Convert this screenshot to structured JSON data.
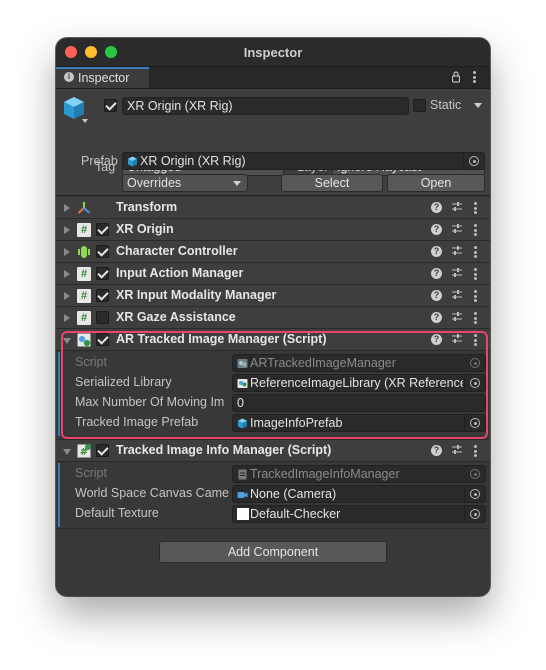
{
  "window": {
    "title": "Inspector"
  },
  "tab": {
    "label": "Inspector"
  },
  "header": {
    "object_name": "XR Origin (XR Rig)",
    "static_label": "Static",
    "tag_label": "Tag",
    "tag_value": "Untagged",
    "layer_label": "Layer",
    "layer_value": "Ignore Raycast",
    "prefab_label": "Prefab",
    "prefab_value": "XR Origin (XR Rig)",
    "overrides_label": "Overrides",
    "select_label": "Select",
    "open_label": "Open"
  },
  "components": [
    {
      "name": "Transform",
      "icon": "transform-icon",
      "has_checkbox": false
    },
    {
      "name": "XR Origin",
      "icon": "script-icon",
      "has_checkbox": true,
      "checked": true
    },
    {
      "name": "Character Controller",
      "icon": "character-controller-icon",
      "has_checkbox": true,
      "checked": true
    },
    {
      "name": "Input Action Manager",
      "icon": "script-icon",
      "has_checkbox": true,
      "checked": true
    },
    {
      "name": "XR Input Modality Manager",
      "icon": "script-icon",
      "has_checkbox": true,
      "checked": true
    },
    {
      "name": "XR Gaze Assistance",
      "icon": "script-icon",
      "has_checkbox": true,
      "checked": false
    },
    {
      "name": "AR Tracked Image Manager (Script)",
      "icon": "ar-tracked-image-icon",
      "has_checkbox": true,
      "checked": true,
      "expanded": true
    }
  ],
  "ar_tracked_image_manager": {
    "properties": [
      {
        "label": "Script",
        "value": "ARTrackedImageManager",
        "icon": "script-asset-icon",
        "dim": true
      },
      {
        "label": "Serialized Library",
        "value": "ReferenceImageLibrary (XR Reference",
        "icon": "image-library-icon"
      },
      {
        "label": "Max Number Of Moving Im",
        "value": "0"
      },
      {
        "label": "Tracked Image Prefab",
        "value": "ImageInfoPrefab",
        "icon": "prefab-icon"
      }
    ]
  },
  "tracked_image_info_manager": {
    "name": "Tracked Image Info Manager (Script)",
    "checked": true,
    "properties": [
      {
        "label": "Script",
        "value": "TrackedImageInfoManager",
        "icon": "script-asset-icon",
        "dim": true
      },
      {
        "label": "World Space Canvas Came",
        "value": "None (Camera)",
        "icon": "camera-icon"
      },
      {
        "label": "Default Texture",
        "value": "Default-Checker",
        "icon": "texture-swatch-icon"
      }
    ]
  },
  "add_component_label": "Add Component",
  "colors": {
    "highlight": "#e5466a",
    "accent_blue": "#3a79bb",
    "panel_bg": "#383838",
    "header_bg": "#3e3e3e"
  }
}
